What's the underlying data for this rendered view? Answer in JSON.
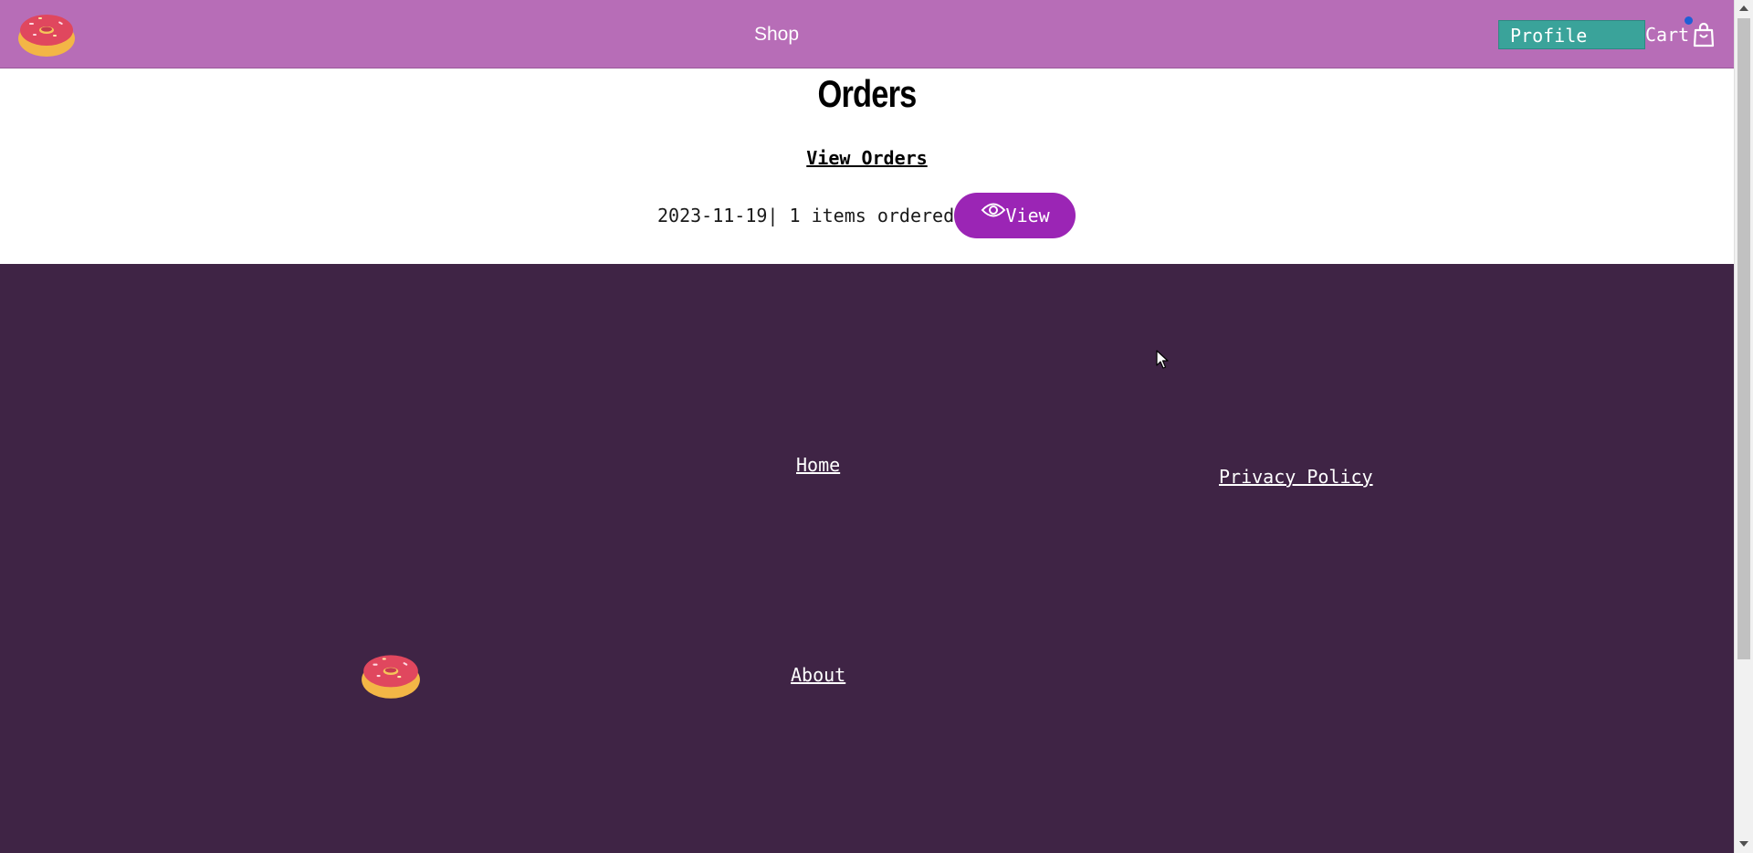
{
  "header": {
    "logo_icon": "donut-icon",
    "shop_label": "Shop",
    "profile_label": "Profile",
    "cart_label": "Cart",
    "cart_icon": "shopping-bag-icon",
    "cart_badge_color": "#1f5fd6"
  },
  "main": {
    "title": "Orders",
    "view_orders_label": "View Orders",
    "orders": [
      {
        "date": "2023-11-19",
        "summary": "| 1 items ordered",
        "view_label": "View",
        "view_icon": "eye-icon"
      }
    ]
  },
  "footer": {
    "logo_icon": "donut-icon",
    "home_label": "Home",
    "about_label": "About",
    "privacy_label": "Privacy Policy"
  },
  "colors": {
    "header_bg": "#b76db7",
    "profile_bg": "#3aa39a",
    "view_button_bg": "#9b25b5",
    "footer_bg": "#3f2445"
  }
}
